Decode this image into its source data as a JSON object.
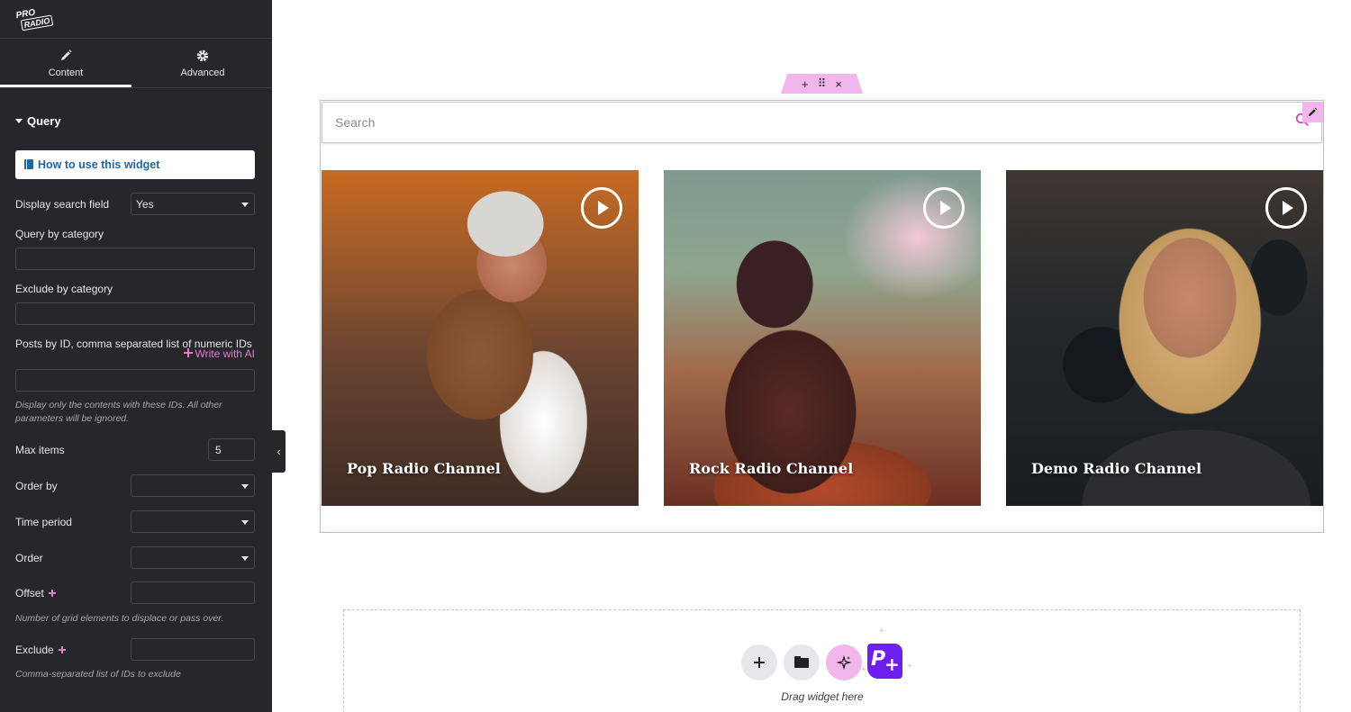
{
  "app": {
    "logo_text_1": "PRO",
    "logo_text_2": "RADIO"
  },
  "sidebar": {
    "tabs": [
      {
        "label": "Content",
        "icon": "pencil-icon",
        "active": true
      },
      {
        "label": "Advanced",
        "icon": "gear-icon",
        "active": false
      }
    ],
    "section_title": "Query",
    "howto_label": "How to use this widget",
    "fields": {
      "display_search": {
        "label": "Display search field",
        "value": "Yes"
      },
      "query_category": {
        "label": "Query by category",
        "value": ""
      },
      "exclude_category": {
        "label": "Exclude by category",
        "value": ""
      },
      "posts_by_id": {
        "label": "Posts by ID, comma separated list of numeric IDs",
        "ai_link": "Write with AI",
        "value": "",
        "help": "Display only the contents with these IDs. All other parameters will be ignored."
      },
      "max_items": {
        "label": "Max items",
        "value": "5"
      },
      "order_by": {
        "label": "Order by",
        "value": ""
      },
      "time_period": {
        "label": "Time period",
        "value": ""
      },
      "order": {
        "label": "Order",
        "value": ""
      },
      "offset": {
        "label": "Offset",
        "value": "",
        "help": "Number of grid elements to displace or pass over."
      },
      "exclude": {
        "label": "Exclude",
        "value": "",
        "help": "Comma-separated list of IDs to exclude"
      }
    },
    "collapse_icon": "‹"
  },
  "canvas": {
    "toolbar": {
      "add": "+",
      "move": "⠿",
      "close": "×"
    },
    "search": {
      "placeholder": "Search"
    },
    "cards": [
      {
        "title": "Pop Radio Channel"
      },
      {
        "title": "Rock Radio Channel"
      },
      {
        "title": "Demo Radio Channel"
      }
    ],
    "dropzone": {
      "text": "Drag widget here",
      "logo_letter": "P",
      "logo_plus": "+"
    }
  },
  "colors": {
    "sidebar_bg": "#26272b",
    "accent_pink": "#f3b6ec",
    "link_blue": "#1d66a8",
    "ai_pink": "#e879d2",
    "brand_purple": "#6d1ef0"
  }
}
